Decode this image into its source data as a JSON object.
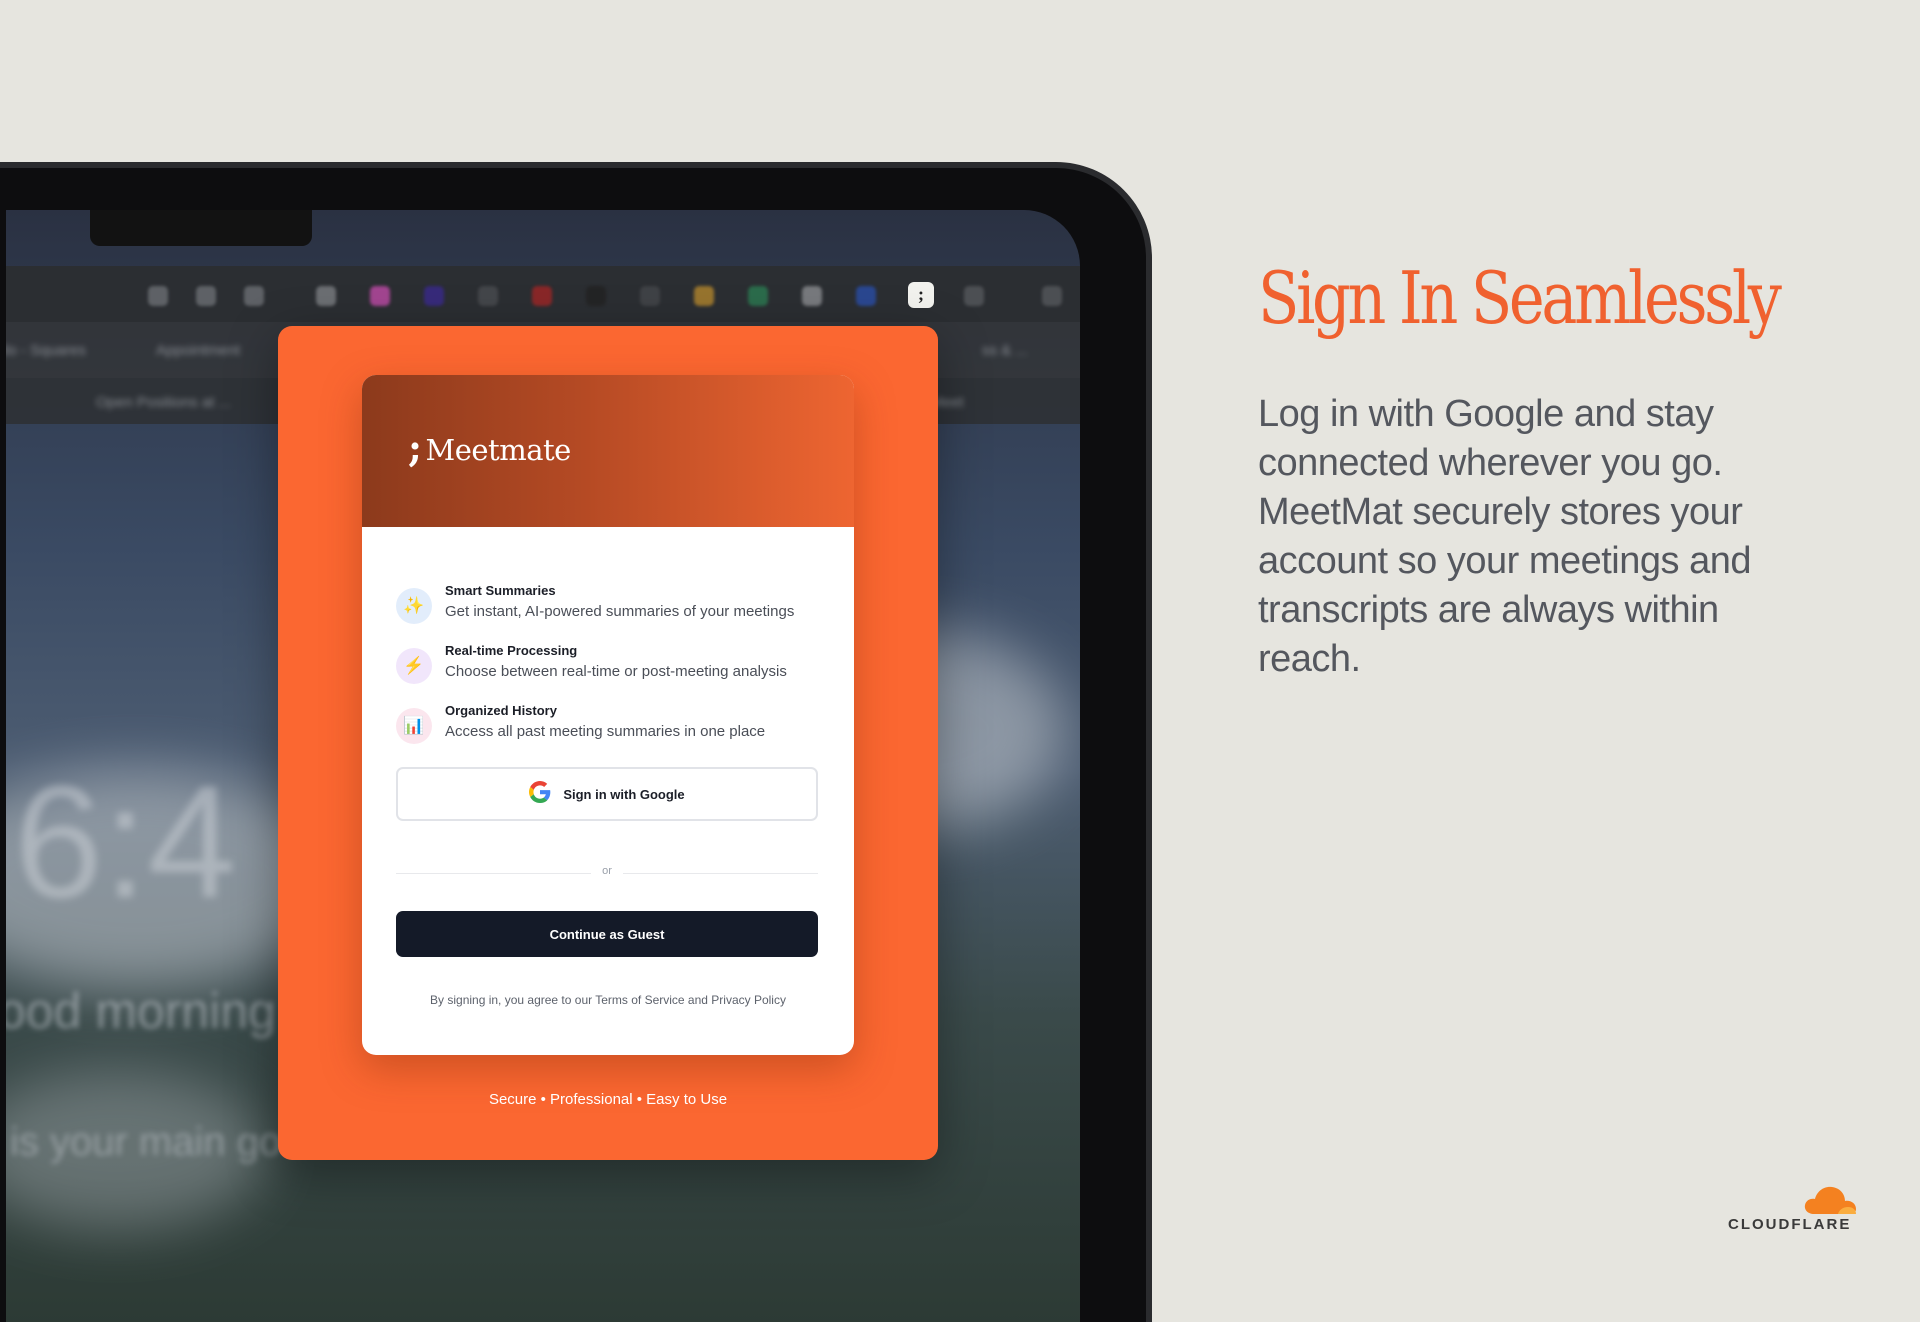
{
  "marketing": {
    "headline": "Sign In Seamlessly",
    "body": "Log in with Google and stay connected wherever you go. MeetMat securely stores your account so your meetings and transcripts are always within reach.",
    "footer_logo": "CLOUDFLARE"
  },
  "background_screen": {
    "clock": "6:4",
    "greeting": "ood morning",
    "prompt": "is your main go",
    "tab_labels": [
      "do - Squares",
      "Appointment",
      "ss & ...",
      "Open Positions at ...",
      "pes Meet"
    ]
  },
  "extension_icon": {
    "glyph": ";",
    "name": "meetmate-extension-icon"
  },
  "popup": {
    "brand": "Meetmate",
    "brand_mark": ";",
    "features": [
      {
        "icon": "sparkles-icon",
        "glyph": "✨",
        "bg": "#e2edfb",
        "title": "Smart Summaries",
        "description": "Get instant, AI-powered summaries of your meetings"
      },
      {
        "icon": "lightning-icon",
        "glyph": "⚡",
        "bg": "#f1e6fb",
        "title": "Real-time Processing",
        "description": "Choose between real-time or post-meeting analysis"
      },
      {
        "icon": "bar-chart-icon",
        "glyph": "📊",
        "bg": "#fbe6ee",
        "title": "Organized History",
        "description": "Access all past meeting summaries in one place"
      }
    ],
    "google_button": "Sign in with Google",
    "divider": "or",
    "guest_button": "Continue as Guest",
    "terms": "By signing in, you agree to our Terms of Service and Privacy Policy",
    "tagline": "Secure • Professional • Easy to Use"
  },
  "colors": {
    "accent": "#fb6731",
    "headline": "#f0612f",
    "guest_button": "#141a28",
    "page_background": "#e6e5df"
  }
}
